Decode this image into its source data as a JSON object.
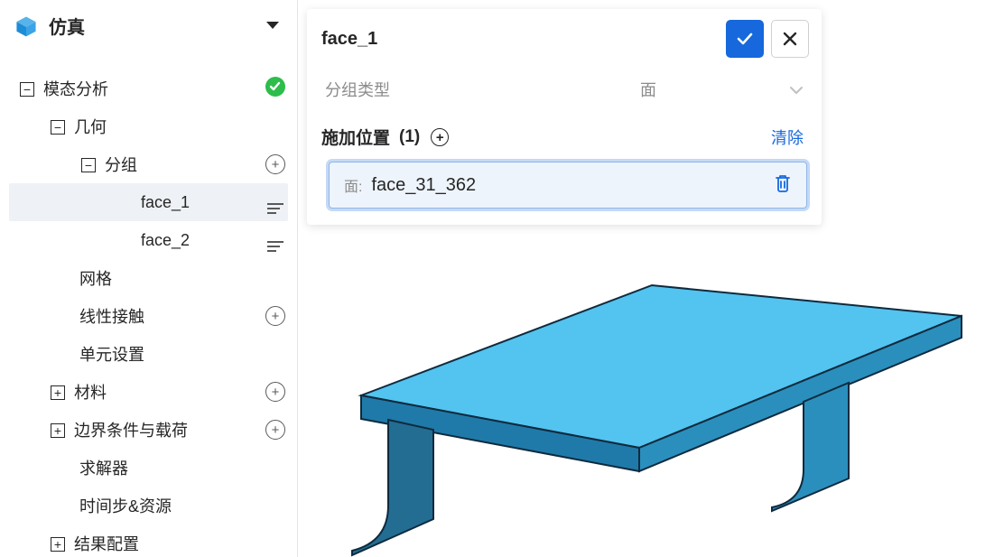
{
  "sidebar": {
    "title": "仿真",
    "tree": {
      "root": {
        "label": "模态分析",
        "status": "ok"
      },
      "geometry": {
        "label": "几何"
      },
      "grouping": {
        "label": "分组"
      },
      "faces": [
        {
          "label": "face_1",
          "selected": true
        },
        {
          "label": "face_2",
          "selected": false
        }
      ],
      "mesh": {
        "label": "网格"
      },
      "linear_contact": {
        "label": "线性接触"
      },
      "element_settings": {
        "label": "单元设置"
      },
      "material": {
        "label": "材料"
      },
      "bc_loads": {
        "label": "边界条件与载荷"
      },
      "solver": {
        "label": "求解器"
      },
      "time_resources": {
        "label": "时间步&资源"
      },
      "results": {
        "label": "结果配置"
      }
    }
  },
  "panel": {
    "title": "face_1",
    "group_type_label": "分组类型",
    "group_type_value": "面",
    "position_label": "施加位置",
    "position_count": "(1)",
    "clear_label": "清除",
    "entry": {
      "type_label": "面:",
      "name": "face_31_362"
    }
  }
}
